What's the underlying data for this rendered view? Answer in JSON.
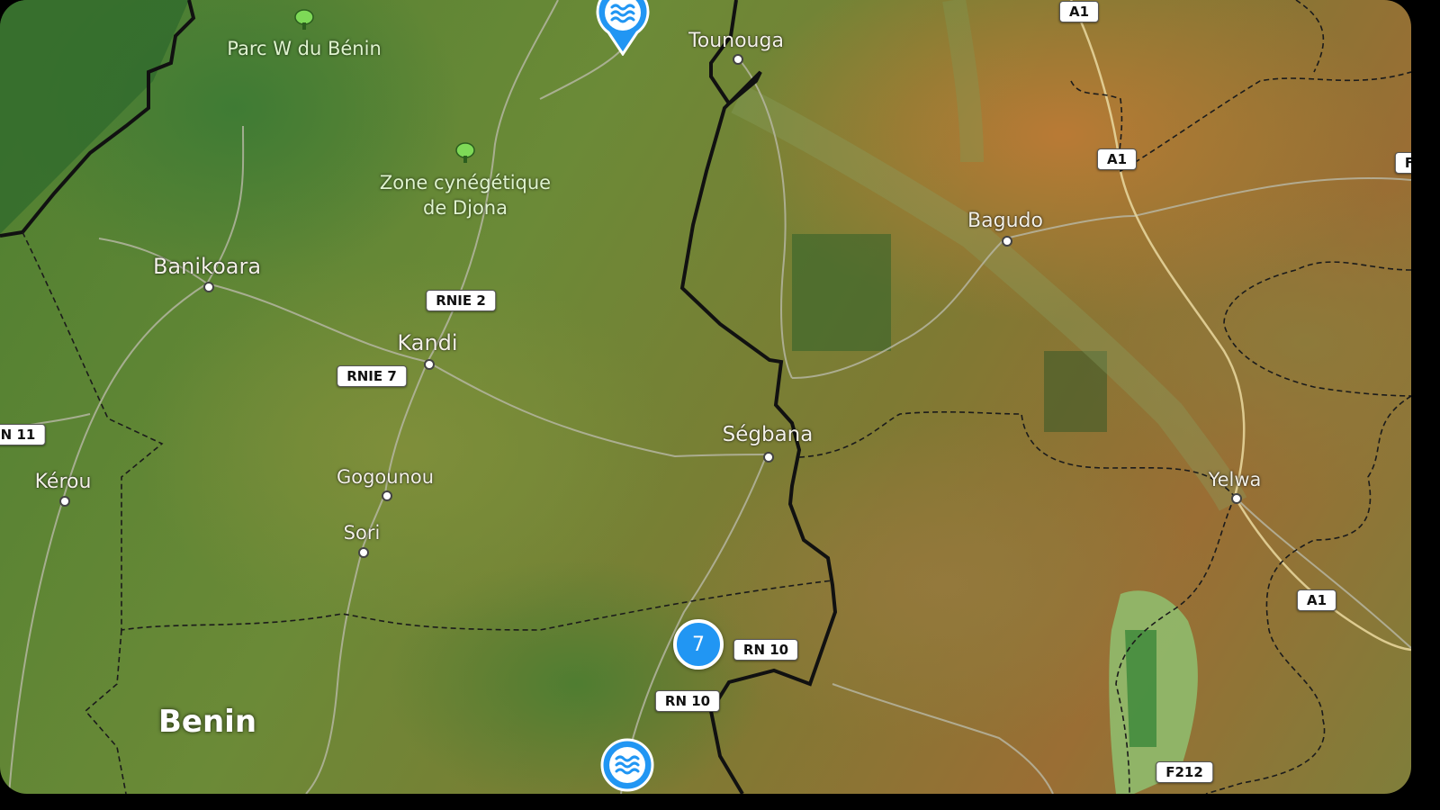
{
  "map": {
    "country_label": "Benin",
    "places": [
      {
        "id": "tounouga",
        "name": "Tounouga"
      },
      {
        "id": "bagudo",
        "name": "Bagudo"
      },
      {
        "id": "banikoara",
        "name": "Banikoara"
      },
      {
        "id": "kandi",
        "name": "Kandi"
      },
      {
        "id": "segbana",
        "name": "Ségbana"
      },
      {
        "id": "gogounou",
        "name": "Gogounou"
      },
      {
        "id": "sori",
        "name": "Sori"
      },
      {
        "id": "kerou",
        "name": "Kérou"
      },
      {
        "id": "yelwa",
        "name": "Yelwa"
      }
    ],
    "parks": [
      {
        "id": "parc-w",
        "name": "Parc W du Bénin"
      },
      {
        "id": "djona",
        "line1": "Zone cynégétique",
        "line2": "de Djona"
      }
    ],
    "road_shields": [
      {
        "id": "a1-top",
        "label": "A1"
      },
      {
        "id": "a1-mid",
        "label": "A1"
      },
      {
        "id": "a1-right",
        "label": "A1"
      },
      {
        "id": "rnie2",
        "label": "RNIE 2"
      },
      {
        "id": "rnie7",
        "label": "RNIE 7"
      },
      {
        "id": "rn11",
        "label": "N 11"
      },
      {
        "id": "rn10-a",
        "label": "RN 10"
      },
      {
        "id": "rn10-b",
        "label": "RN 10"
      },
      {
        "id": "f212",
        "label": "F212"
      },
      {
        "id": "edge-right",
        "label": "F"
      }
    ],
    "cluster": {
      "count": "7",
      "color": "#2196f3"
    },
    "markers": [
      {
        "id": "water-marker-top",
        "icon": "water-waves-icon",
        "color": "#2196f3"
      },
      {
        "id": "water-marker-bottom",
        "icon": "water-waves-icon",
        "color": "#2196f3"
      }
    ]
  }
}
